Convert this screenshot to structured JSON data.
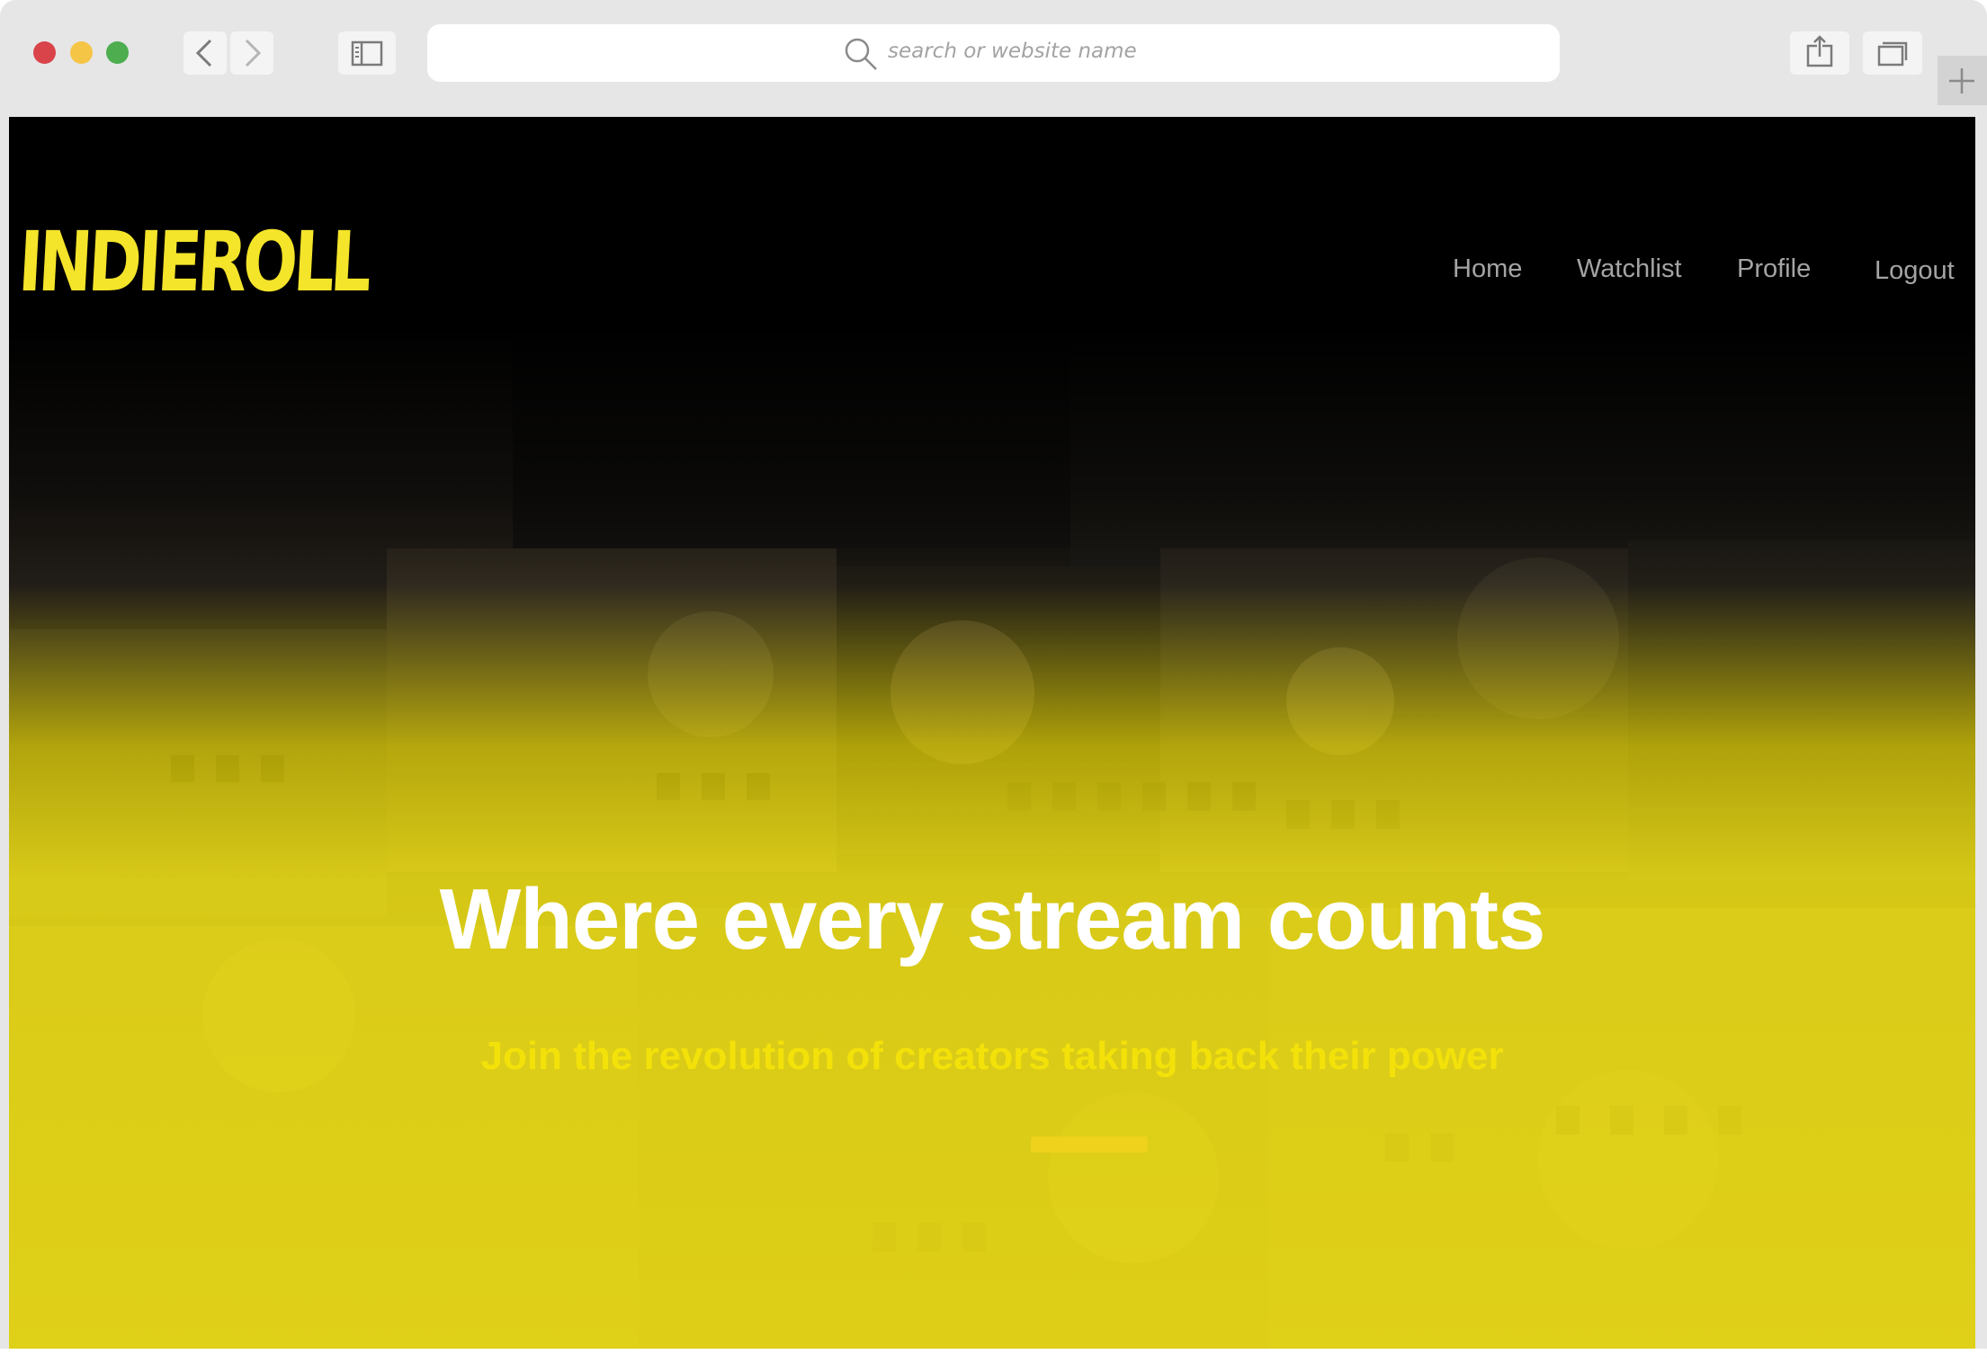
{
  "browser": {
    "address_placeholder": "search or website name"
  },
  "site": {
    "logo_text": "INDIEROLL",
    "nav": {
      "home": "Home",
      "watchlist": "Watchlist",
      "profile": "Profile",
      "logout": "Logout"
    },
    "hero": {
      "headline": "Where every stream counts",
      "subheadline": "Join the revolution of creators taking back their power"
    }
  },
  "colors": {
    "brand_yellow": "#f4e42a",
    "hero_yellow": "#e8d814",
    "nav_text": "#a4a4a4",
    "headline": "#ffffff",
    "subheadline": "#f3e10a"
  },
  "icons": {
    "back": "chevron-left-icon",
    "forward": "chevron-right-icon",
    "sidebar": "sidebar-icon",
    "search": "search-icon",
    "share": "share-icon",
    "tabs": "tabs-icon",
    "new_tab": "plus-icon"
  }
}
